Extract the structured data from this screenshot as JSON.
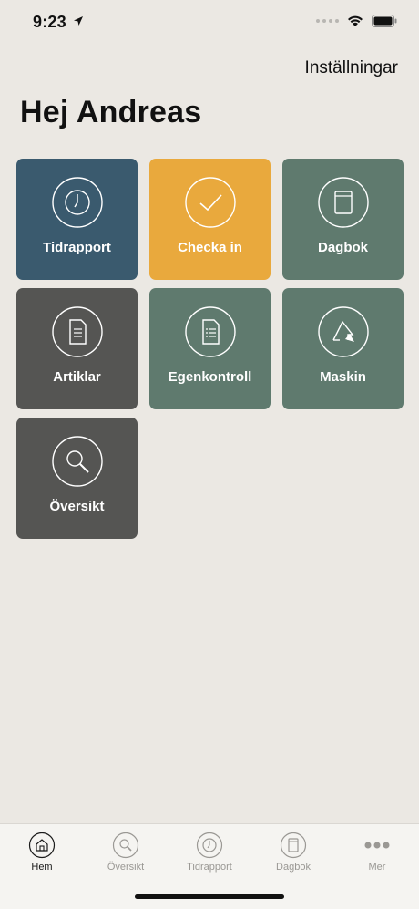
{
  "status_bar": {
    "time": "9:23"
  },
  "header": {
    "settings_label": "Inställningar",
    "title": "Hej Andreas"
  },
  "tiles": [
    {
      "label": "Tidrapport",
      "icon": "clock-icon",
      "color": "#3a5a6e"
    },
    {
      "label": "Checka in",
      "icon": "checkmark-icon",
      "color": "#e9a93d"
    },
    {
      "label": "Dagbok",
      "icon": "book-icon",
      "color": "#5f7a6e"
    },
    {
      "label": "Artiklar",
      "icon": "document-icon",
      "color": "#555553"
    },
    {
      "label": "Egenkontroll",
      "icon": "checklist-document-icon",
      "color": "#5f7a6e"
    },
    {
      "label": "Maskin",
      "icon": "machine-icon",
      "color": "#5f7a6e"
    },
    {
      "label": "Översikt",
      "icon": "magnifier-icon",
      "color": "#555553"
    }
  ],
  "tab_bar": {
    "items": [
      {
        "label": "Hem",
        "icon": "home-icon",
        "active": true
      },
      {
        "label": "Översikt",
        "icon": "magnifier-icon",
        "active": false
      },
      {
        "label": "Tidrapport",
        "icon": "clock-icon",
        "active": false
      },
      {
        "label": "Dagbok",
        "icon": "book-icon",
        "active": false
      },
      {
        "label": "Mer",
        "icon": "more-dots-icon",
        "active": false
      }
    ],
    "active_color": "#1a1a1a",
    "inactive_color": "#9a9894"
  }
}
